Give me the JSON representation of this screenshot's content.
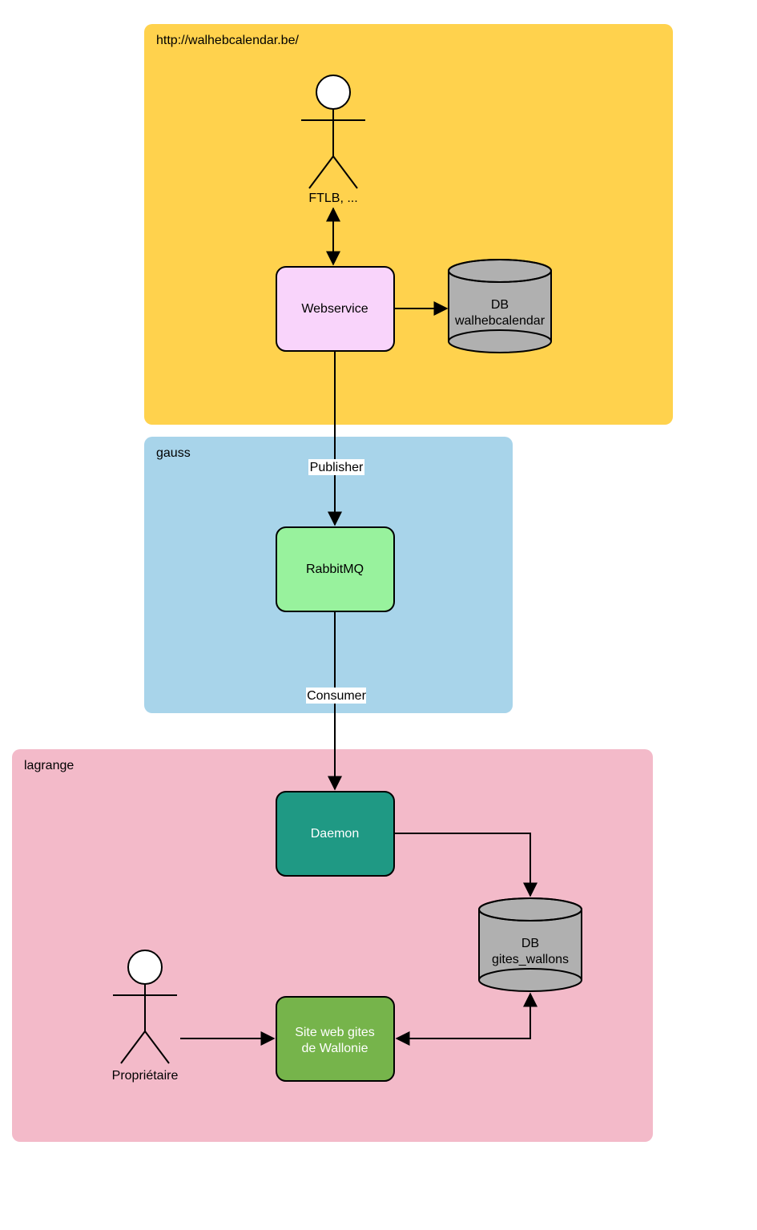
{
  "containers": {
    "top": {
      "title": "http://walhebcalendar.be/"
    },
    "mid": {
      "title": "gauss"
    },
    "bottom": {
      "title": "lagrange"
    }
  },
  "actors": {
    "ftlb": {
      "label": "FTLB, ..."
    },
    "proprietaire": {
      "label": "Propriétaire"
    }
  },
  "nodes": {
    "webservice": {
      "label": "Webservice"
    },
    "db_walheb_l1": {
      "label": "DB"
    },
    "db_walheb_l2": {
      "label": "walhebcalendar"
    },
    "rabbitmq": {
      "label": "RabbitMQ"
    },
    "daemon": {
      "label": "Daemon"
    },
    "db_gites_l1": {
      "label": "DB"
    },
    "db_gites_l2": {
      "label": "gites_wallons"
    },
    "siteweb_l1": {
      "label": "Site web gites"
    },
    "siteweb_l2": {
      "label": "de Wallonie"
    }
  },
  "edges": {
    "publisher": {
      "label": "Publisher"
    },
    "consumer": {
      "label": "Consumer"
    }
  }
}
